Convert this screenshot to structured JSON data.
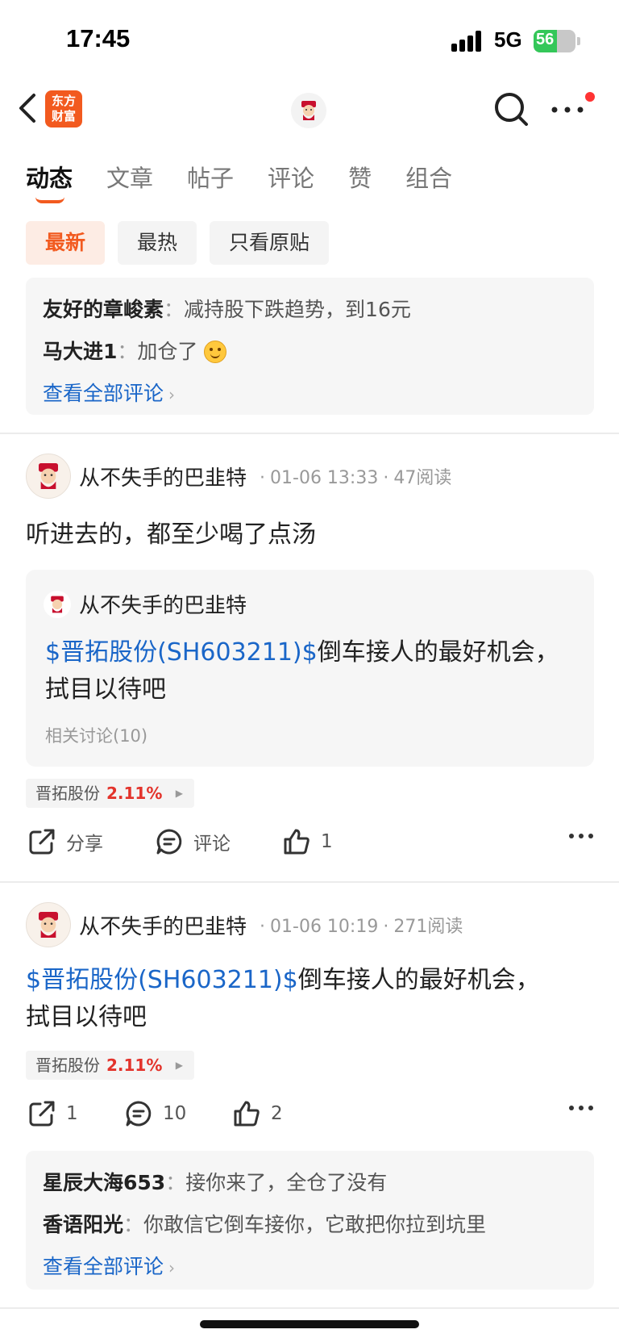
{
  "status_bar": {
    "time": "17:45",
    "network": "5G",
    "battery": "56"
  },
  "nav": {
    "logo_line1": "东方",
    "logo_line2": "财富"
  },
  "tabs": [
    {
      "label": "动态"
    },
    {
      "label": "文章"
    },
    {
      "label": "帖子"
    },
    {
      "label": "评论"
    },
    {
      "label": "赞"
    },
    {
      "label": "组合"
    }
  ],
  "filters": [
    {
      "label": "最新"
    },
    {
      "label": "最热"
    },
    {
      "label": "只看原贴"
    }
  ],
  "top_comments": {
    "items": [
      {
        "author": "友好的章峻素",
        "text": "减持股下跌趋势，到16元"
      },
      {
        "author": "马大进1",
        "text": "加仓了"
      }
    ],
    "view_all": "查看全部评论"
  },
  "post1": {
    "author": "从不失手的巴韭特",
    "time": "01-06 13:33",
    "reads": "47阅读",
    "text": "听进去的，都至少喝了点汤",
    "repost": {
      "author": "从不失手的巴韭特",
      "stock_link": "$晋拓股份(SH603211)$",
      "text_line1": "倒车接人的最好机会，",
      "text_line2": "拭目以待吧",
      "related": "相关讨论(10)"
    },
    "stock_tag": {
      "name": "晋拓股份",
      "change": "2.11%"
    },
    "actions": {
      "share": "分享",
      "comment": "评论",
      "like": "1"
    }
  },
  "post2": {
    "author": "从不失手的巴韭特",
    "time": "01-06 10:19",
    "reads": "271阅读",
    "stock_link": "$晋拓股份(SH603211)$",
    "text_line1": "倒车接人的最好机会，",
    "text_line2": "拭目以待吧",
    "stock_tag": {
      "name": "晋拓股份",
      "change": "2.11%"
    },
    "actions": {
      "share": "1",
      "comment": "10",
      "like": "2"
    },
    "comments": {
      "items": [
        {
          "author": "星辰大海653",
          "text": "接你来了，全仓了没有"
        },
        {
          "author": "香语阳光",
          "text": "你敢信它倒车接你，它敢把你拉到坑里"
        }
      ],
      "view_all": "查看全部评论"
    }
  }
}
